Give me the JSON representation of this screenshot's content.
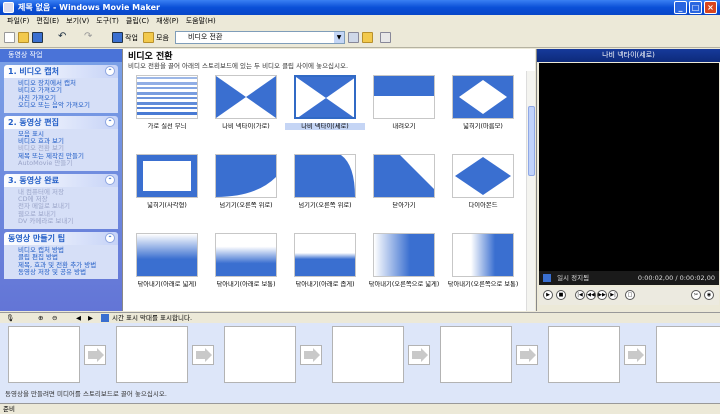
{
  "window": {
    "title": "제목 없음 - Windows Movie Maker"
  },
  "menu": [
    "파일(F)",
    "편집(E)",
    "보기(V)",
    "도구(T)",
    "클립(C)",
    "재생(P)",
    "도움말(H)"
  ],
  "toolbar": {
    "tasks_label": "작업",
    "collections_label": "모음",
    "collection_value": "비디오 전환"
  },
  "taskpane": {
    "header": "동영상 작업",
    "sections": [
      {
        "title": "1. 비디오 캡처",
        "items": [
          {
            "t": "비디오 장치에서 캡처",
            "d": false
          },
          {
            "t": "비디오 가져오기",
            "d": false
          },
          {
            "t": "사진 가져오기",
            "d": false
          },
          {
            "t": "오디오 또는 음악 가져오기",
            "d": false
          }
        ]
      },
      {
        "title": "2. 동영상 편집",
        "items": [
          {
            "t": "모음 표시",
            "d": false
          },
          {
            "t": "비디오 효과 보기",
            "d": false
          },
          {
            "t": "비디오 전환 보기",
            "d": true
          },
          {
            "t": "제목 또는 제작진 만들기",
            "d": false
          },
          {
            "t": "AutoMovie 만들기",
            "d": true
          }
        ]
      },
      {
        "title": "3. 동영상 완료",
        "items": [
          {
            "t": "내 컴퓨터에 저장",
            "d": true
          },
          {
            "t": "CD에 저장",
            "d": true
          },
          {
            "t": "전자 메일로 보내기",
            "d": true
          },
          {
            "t": "웹으로 보내기",
            "d": true
          },
          {
            "t": "DV 카메라로 보내기",
            "d": true
          }
        ]
      },
      {
        "title": "동영상 만들기 팁",
        "items": [
          {
            "t": "비디오 캡처 방법",
            "d": false
          },
          {
            "t": "클립 편집 방법",
            "d": false
          },
          {
            "t": "제목, 효과 및 전환 추가 방법",
            "d": false
          },
          {
            "t": "동영상 저장 및 공유 방법",
            "d": false
          }
        ]
      }
    ]
  },
  "content": {
    "title": "비디오 전환",
    "description": "비디오 전환을 끌어 아래의 스토리보드에 있는 두 비디오 클립 사이에 놓으십시오.",
    "transitions": [
      {
        "label": "가로 실선 무늬",
        "kind": "stripes"
      },
      {
        "label": "나비 넥타이(가로)",
        "kind": "bowtie-h"
      },
      {
        "label": "나비 넥타이(세로)",
        "kind": "bowtie-v",
        "selected": true
      },
      {
        "label": "내려오기",
        "kind": "down"
      },
      {
        "label": "넓히기(마름모)",
        "kind": "diamond-out"
      },
      {
        "label": "넓히기(사각형)",
        "kind": "rect-out"
      },
      {
        "label": "넘기기(오른쪽 위로)",
        "kind": "curl-ur"
      },
      {
        "label": "넘기기(오른쪽 위로)",
        "kind": "curl-ur2"
      },
      {
        "label": "닫아가기",
        "kind": "diag"
      },
      {
        "label": "다이아몬드",
        "kind": "diamond"
      },
      {
        "label": "닦아내기(아래로 넓게)",
        "kind": "wipe-down-wide"
      },
      {
        "label": "닦아내기(아래로 보통)",
        "kind": "wipe-down"
      },
      {
        "label": "닦아내기(아래로 좁게)",
        "kind": "wipe-down-narrow"
      },
      {
        "label": "닦아내기(오른쪽으로 넓게)",
        "kind": "wipe-right-wide"
      },
      {
        "label": "닦아내기(오른쪽으로 보통)",
        "kind": "wipe-right"
      }
    ]
  },
  "monitor": {
    "title": "나비 넥타이(세로)",
    "status": "일시 정지됨",
    "time": "0:00:02,00 / 0:00:02,00"
  },
  "storyboard": {
    "toolbar_text": "시간 표시 막대를 표시합니다.",
    "hint": "동영상을 만들려면 미디어를 스토리보드로 끌어 놓으십시오."
  },
  "statusbar": {
    "text": "준비"
  },
  "colors": {
    "accent": "#316ac5",
    "tile_blue": "#3a6fd0",
    "title_blue": "#0a4fd7"
  }
}
